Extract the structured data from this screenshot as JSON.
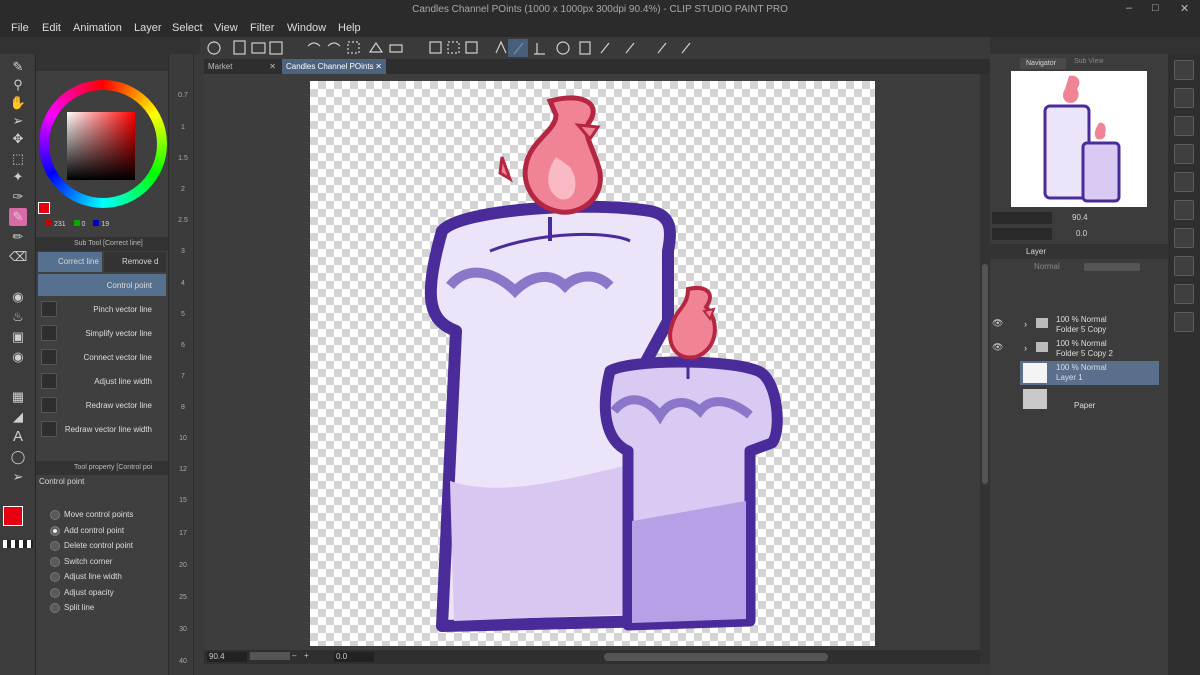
{
  "window": {
    "title": "Candles Channel POints (1000 x 1000px 300dpi 90.4%) - CLIP STUDIO PAINT PRO"
  },
  "menu": [
    "File",
    "Edit",
    "Animation",
    "Layer",
    "Select",
    "View",
    "Filter",
    "Window",
    "Help"
  ],
  "tabs": [
    "Market",
    "Candles Channel POints"
  ],
  "color": {
    "r": "231",
    "g": "0",
    "b": "19",
    "accent": "#e7000f"
  },
  "subtool": {
    "header": "Sub Tool [Correct line]",
    "tabs": [
      "Correct line",
      "Remove d"
    ],
    "items": [
      "Control point",
      "Pinch vector line",
      "Simplify vector line",
      "Connect vector line",
      "Adjust line width",
      "Redraw vector line",
      "Redraw vector line width"
    ]
  },
  "toolprop": {
    "header": "Tool property [Control poi",
    "title": "Control point",
    "options": [
      "Move control points",
      "Add control point",
      "Delete control point",
      "Switch corner",
      "Adjust line width",
      "Adjust opacity",
      "Split line"
    ],
    "selected": 1
  },
  "ruler": [
    "0.7",
    "1",
    "1.5",
    "2",
    "2.5",
    "3",
    "4",
    "5",
    "6",
    "7",
    "8",
    "10",
    "12",
    "15",
    "17",
    "20",
    "25",
    "30",
    "40"
  ],
  "status": {
    "zoom": "90.4",
    "angle": "0.0"
  },
  "navigator": {
    "tabs": [
      "Navigator",
      "Sub View"
    ],
    "zoom": "90.4",
    "angle": "0.0"
  },
  "layerpanel": {
    "tab": "Layer",
    "blend": "Normal",
    "layers": [
      {
        "mode": "100 % Normal",
        "name": "Folder 5 Copy"
      },
      {
        "mode": "100 % Normal",
        "name": "Folder 5 Copy 2"
      },
      {
        "mode": "100 % Normal",
        "name": "Layer 1"
      },
      {
        "mode": "",
        "name": "Paper"
      }
    ]
  },
  "icons": [
    "pen-icon",
    "zoom-icon",
    "hand-icon",
    "select-icon",
    "move-icon",
    "marquee-icon",
    "wand-icon",
    "eyedropper-icon",
    "brush-icon",
    "eraser-icon",
    "fill-icon",
    "gradient-icon",
    "shape-icon",
    "text-icon",
    "balloon-icon",
    "operation-icon"
  ]
}
